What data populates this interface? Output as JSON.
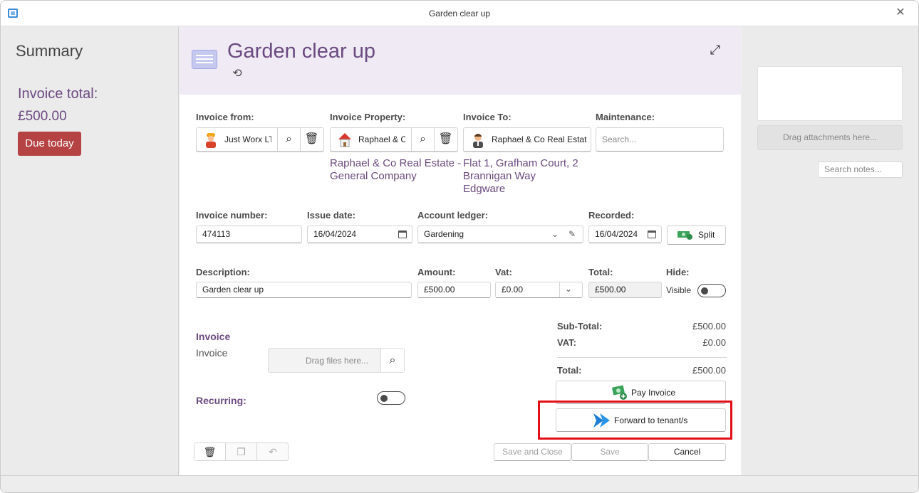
{
  "window": {
    "title": "Garden clear up"
  },
  "left": {
    "summary": "Summary",
    "invoice_total_label": "Invoice total:",
    "invoice_total": "£500.00",
    "due_badge": "Due today"
  },
  "header": {
    "title": "Garden clear up"
  },
  "invoice_from": {
    "label": "Invoice from:",
    "value": "Just Worx LT"
  },
  "invoice_property": {
    "label": "Invoice Property:",
    "value": "Raphael & C",
    "address_line1": "Raphael & Co Real Estate -",
    "address_line2": "General Company"
  },
  "invoice_to": {
    "label": "Invoice To:",
    "value": "Raphael & Co Real Estate",
    "address_line1": "Flat 1, Grafham Court, 2",
    "address_line2": "Brannigan Way",
    "address_line3": "Edgware"
  },
  "maintenance": {
    "label": "Maintenance:",
    "placeholder": "Search..."
  },
  "invoice_number": {
    "label": "Invoice number:",
    "value": "474113"
  },
  "issue_date": {
    "label": "Issue date:",
    "value": "16/04/2024"
  },
  "account_ledger": {
    "label": "Account ledger:",
    "value": "Gardening"
  },
  "recorded": {
    "label": "Recorded:",
    "value": "16/04/2024"
  },
  "split_button": "Split",
  "description": {
    "label": "Description:",
    "value": "Garden clear up"
  },
  "amount": {
    "label": "Amount:",
    "value": "£500.00"
  },
  "vat": {
    "label": "Vat:",
    "value": "£0.00"
  },
  "total_field": {
    "label": "Total:",
    "value": "£500.00"
  },
  "hide": {
    "label": "Hide:",
    "state_label": "Visible"
  },
  "invoice_section": {
    "heading": "Invoice",
    "subheading": "Invoice",
    "drop_label": "Drag files here..."
  },
  "recurring": {
    "label": "Recurring:"
  },
  "totals": {
    "subtotal_label": "Sub-Total:",
    "subtotal": "£500.00",
    "vat_label": "VAT:",
    "vat": "£0.00",
    "total_label": "Total:",
    "total": "£500.00"
  },
  "actions": {
    "pay_invoice": "Pay Invoice",
    "forward": "Forward to tenant/s",
    "save_and_close": "Save and Close",
    "save": "Save",
    "cancel": "Cancel"
  },
  "right": {
    "drag_attachments": "Drag attachments here...",
    "search_notes": "Search notes..."
  },
  "colors": {
    "accent_purple": "#6b4a80",
    "due_red": "#b64343",
    "highlight_red": "#e30e16",
    "forward_blue": "#1f7fd6"
  }
}
